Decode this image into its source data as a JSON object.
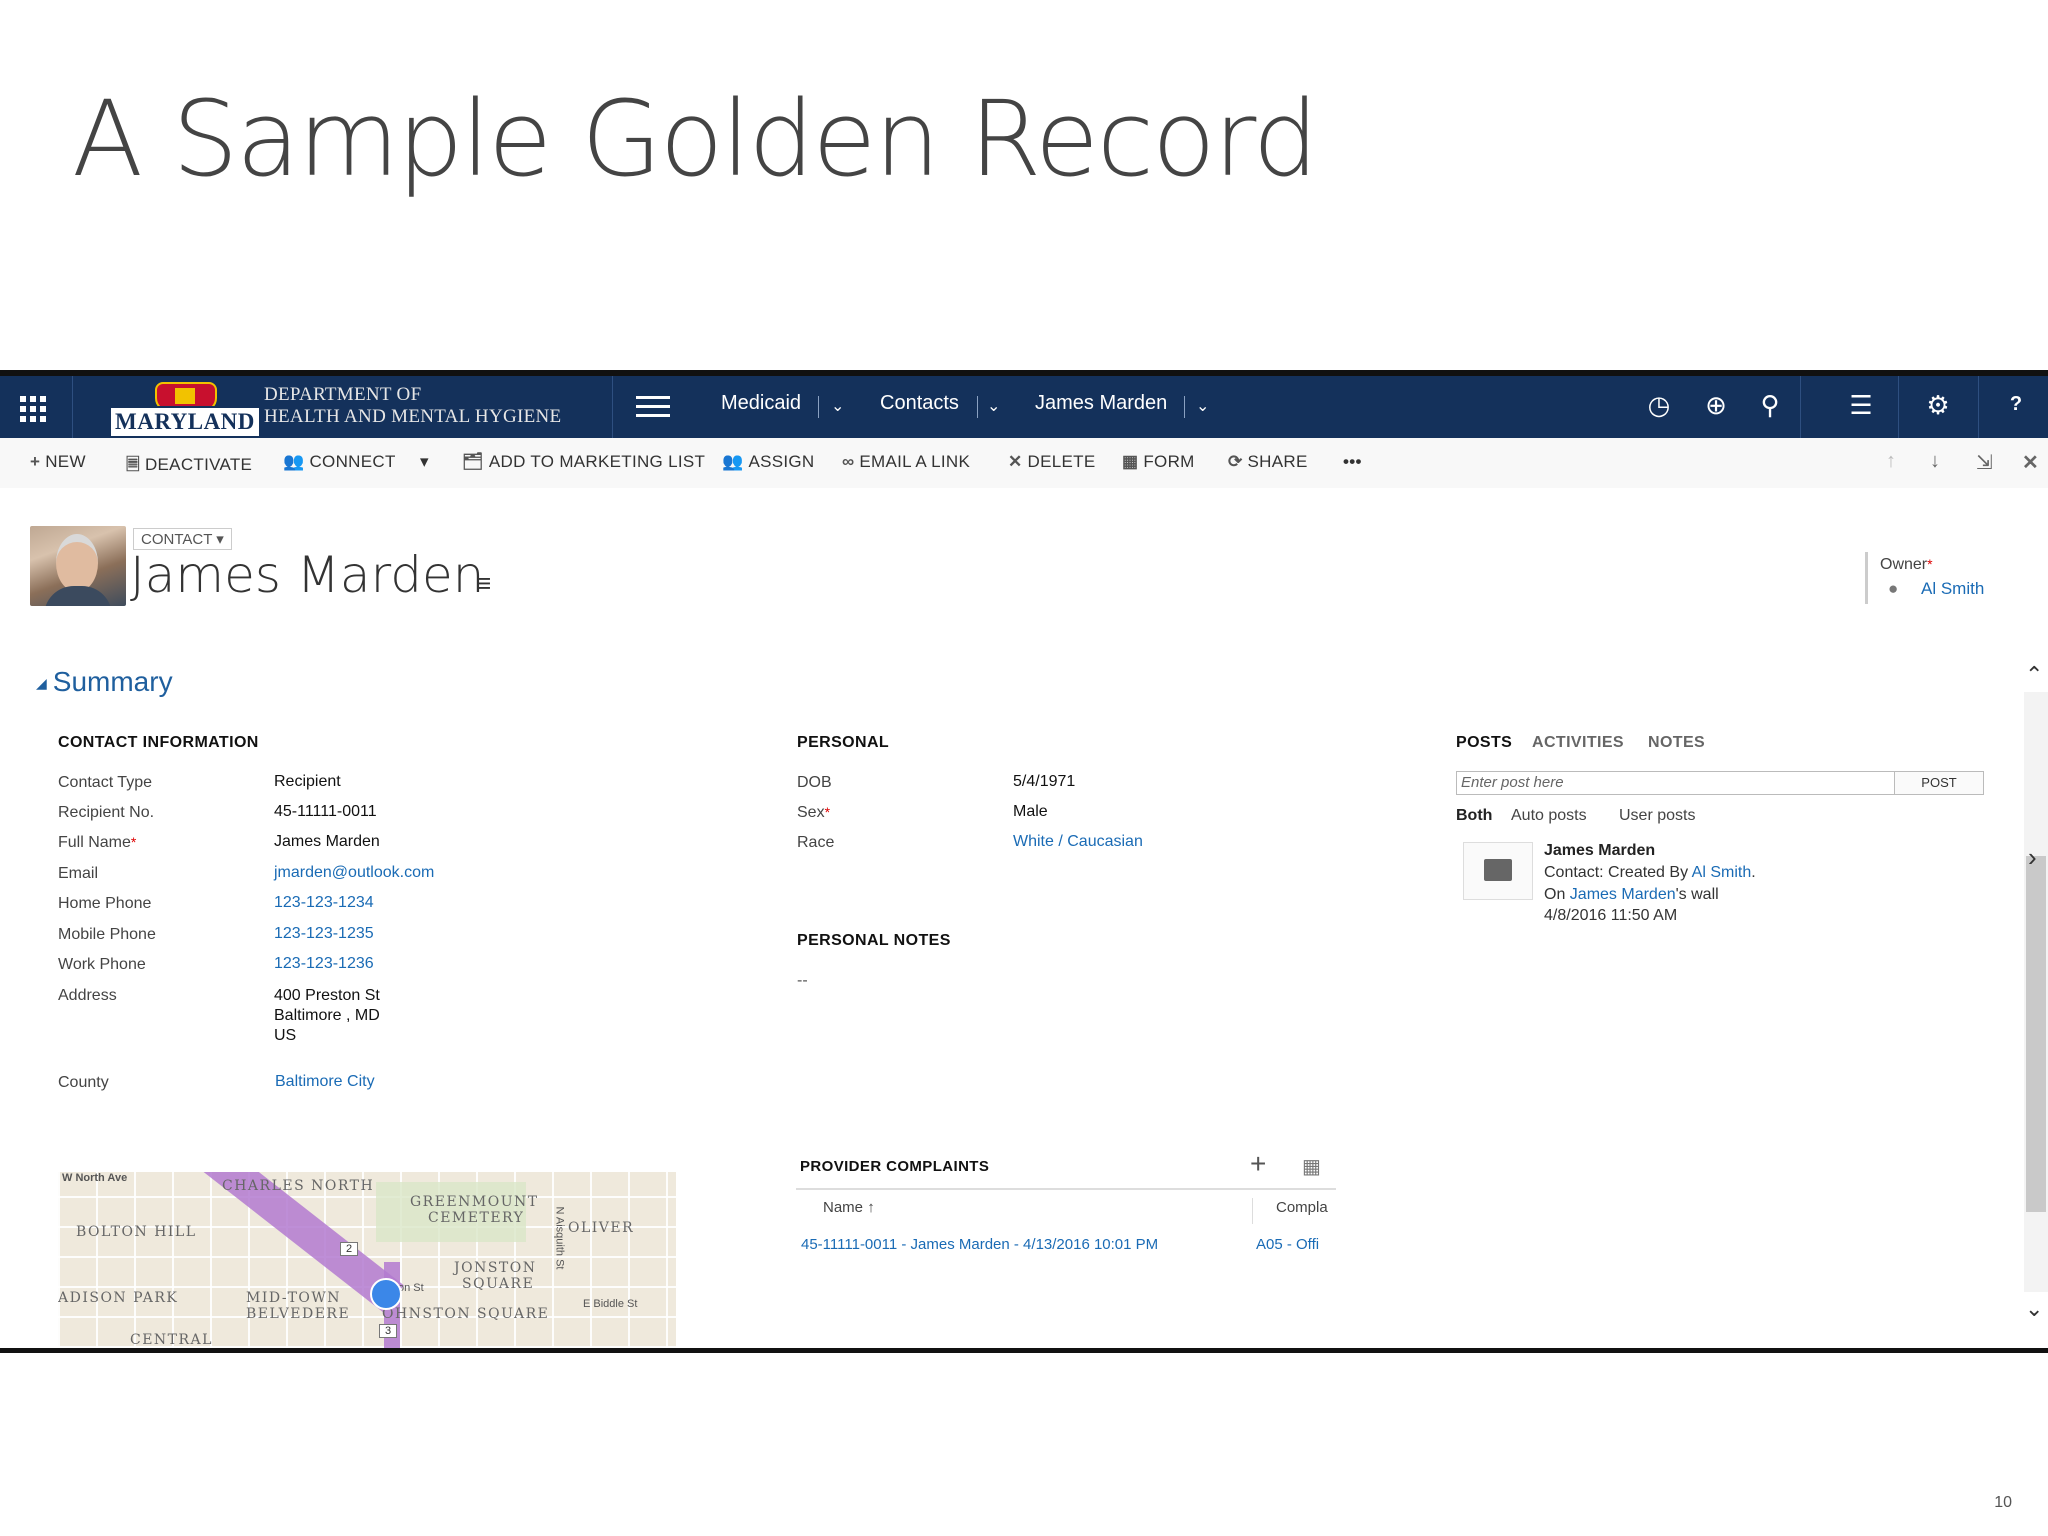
{
  "slide": {
    "title": "A Sample Golden Record",
    "page_number": "10"
  },
  "nav": {
    "logo_word": "MARYLAND",
    "logo_dept_line1": "DEPARTMENT OF",
    "logo_dept_line2": "HEALTH AND MENTAL HYGIENE",
    "crumbs": [
      "Medicaid",
      "Contacts",
      "James Marden"
    ],
    "help": "?"
  },
  "toolbar": {
    "new": "NEW",
    "deactivate": "DEACTIVATE",
    "connect": "CONNECT",
    "add_to_marketing_list": "ADD TO MARKETING LIST",
    "assign": "ASSIGN",
    "email_a_link": "EMAIL A LINK",
    "delete": "DELETE",
    "form": "FORM",
    "share": "SHARE",
    "more": "•••"
  },
  "header": {
    "entity_type": "CONTACT",
    "name": "James Marden",
    "owner_label": "Owner",
    "owner_name": "Al Smith"
  },
  "summary_label": "Summary",
  "contact_info": {
    "heading": "CONTACT INFORMATION",
    "fields": [
      {
        "label": "Contact Type",
        "value": "Recipient"
      },
      {
        "label": "Recipient No.",
        "value": "45-11111-0011"
      },
      {
        "label": "Full Name",
        "value": "James Marden"
      },
      {
        "label": "Email",
        "value": "jmarden@outlook.com"
      },
      {
        "label": "Home Phone",
        "value": "123-123-1234"
      },
      {
        "label": "Mobile Phone",
        "value": "123-123-1235"
      },
      {
        "label": "Work Phone",
        "value": "123-123-1236"
      }
    ],
    "address_label": "Address",
    "address_lines": [
      "400 Preston St",
      "Baltimore , MD",
      "US"
    ],
    "county_label": "County",
    "county_value": "Baltimore City"
  },
  "map": {
    "labels": [
      "CHARLES NORTH",
      "GREENMOUNT",
      "CEMETERY",
      "BOLTON HILL",
      "OLIVER",
      "JONSTON",
      "SQUARE",
      "ADISON PARK",
      "MID-TOWN",
      "BELVEDERE",
      "OHNSTON SQUARE",
      "CENTRAL",
      "W North Ave",
      "on St",
      "E Biddle St",
      "N Aisquith St"
    ],
    "route_shields": [
      "2",
      "3"
    ]
  },
  "personal": {
    "heading": "PERSONAL",
    "fields": [
      {
        "label": "DOB",
        "value": "5/4/1971"
      },
      {
        "label": "Sex",
        "value": "Male"
      },
      {
        "label": "Race",
        "value": "White / Caucasian"
      }
    ],
    "notes_heading": "PERSONAL NOTES",
    "notes_value": "--"
  },
  "posts": {
    "tabs": [
      "POSTS",
      "ACTIVITIES",
      "NOTES"
    ],
    "input_placeholder": "Enter post here",
    "post_button": "POST",
    "filters": [
      "Both",
      "Auto posts",
      "User posts"
    ],
    "item": {
      "author": "James Marden",
      "line1_prefix": "Contact: Created By ",
      "line1_link": "Al Smith",
      "line1_suffix": ".",
      "line2_prefix": "On ",
      "line2_link": "James Marden",
      "line2_suffix": "'s wall",
      "timestamp": "4/8/2016 11:50 AM"
    }
  },
  "complaints": {
    "heading": "PROVIDER COMPLAINTS",
    "col_name": "Name",
    "col_compl": "Compla",
    "row_name": "45-11111-0011 - James Marden - 4/13/2016 10:01 PM",
    "row_compl": "A05 - Offi"
  },
  "colors": {
    "nav_bg": "#14315b",
    "link": "#1a6bb5",
    "accent_title": "#1f5f9e"
  }
}
